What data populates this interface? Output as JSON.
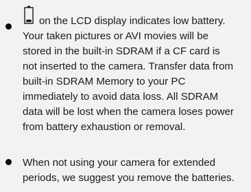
{
  "notes": [
    {
      "icon": "low-battery-icon",
      "first_line": "on the LCD display indicates low battery.",
      "lines": [
        "Your taken pictures or AVI movies will be",
        "stored in the built-in SDRAM if a CF card is",
        "not inserted to the camera. Transfer data from",
        "built-in SDRAM Memory to your PC",
        "immediately to avoid data loss. All SDRAM",
        "data will be lost when the camera loses power",
        "from battery exhaustion or removal."
      ]
    },
    {
      "lines": [
        "When not using your camera for extended",
        "periods, we suggest you remove the batteries."
      ]
    }
  ],
  "colors": {
    "background": "#f2f2f2",
    "text": "#1a1a1a",
    "bullet": "#0b0b0b"
  }
}
